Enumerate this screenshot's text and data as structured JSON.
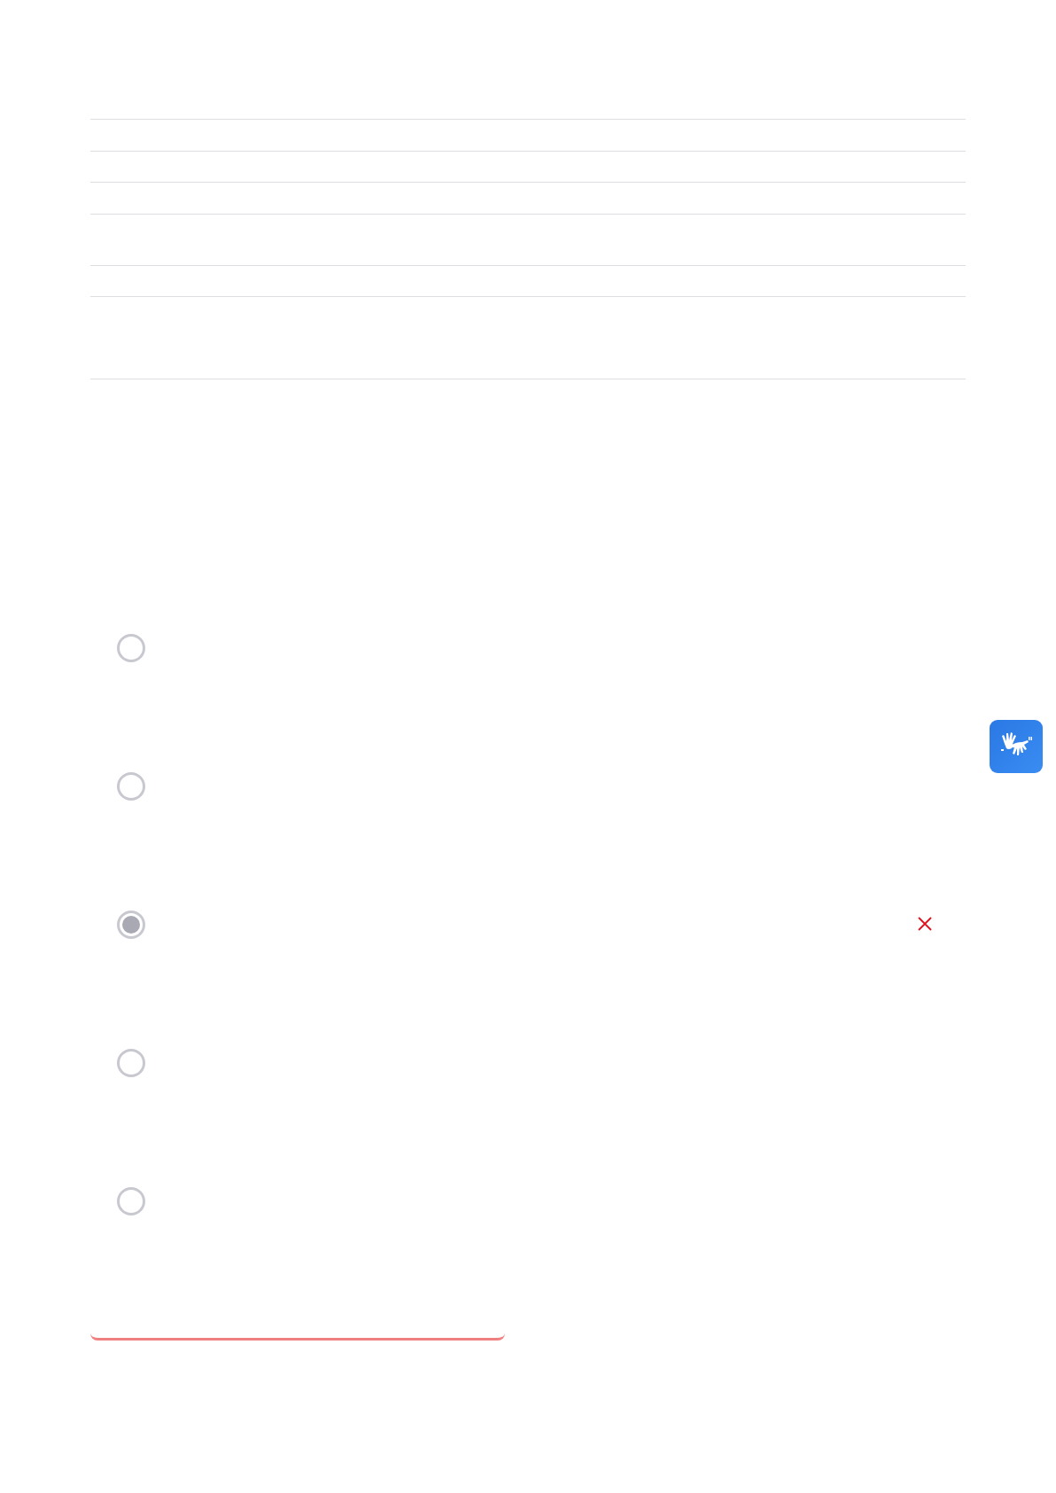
{
  "answer_options": [
    {
      "selected": false,
      "incorrect": false
    },
    {
      "selected": false,
      "incorrect": false
    },
    {
      "selected": true,
      "incorrect": true
    },
    {
      "selected": false,
      "incorrect": false
    },
    {
      "selected": false,
      "incorrect": false
    }
  ],
  "answer_bar": {
    "kind": "error"
  }
}
